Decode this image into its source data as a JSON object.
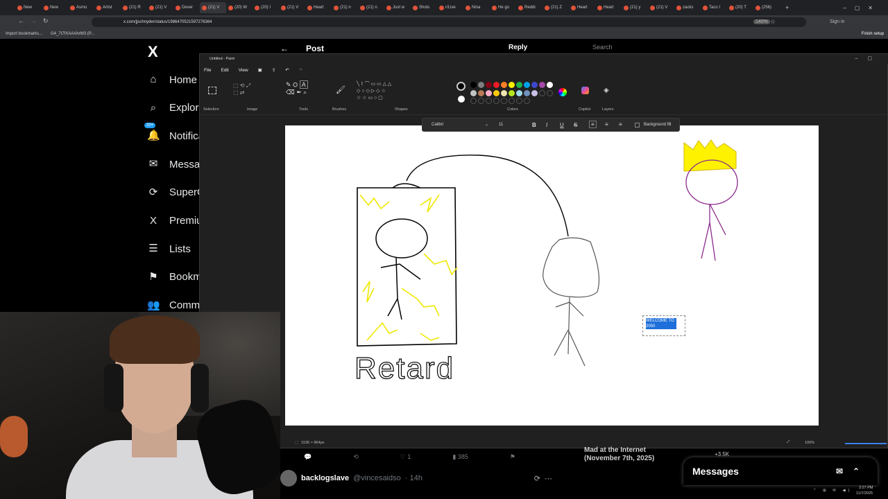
{
  "browser": {
    "tabs": [
      "New",
      "New",
      "Asmo",
      "Artist",
      "(21) R",
      "(21) V",
      "Deser",
      "(21) V",
      "(20) W",
      "(20) I",
      "(21) V",
      "Heart",
      "(21) n",
      "(21) n",
      "Just w",
      "Shots",
      "r/Live",
      "Nina",
      "He go",
      "Reddi",
      "(21) Z",
      "Heart",
      "Heart",
      "(21) y",
      "(21) V",
      "zacks",
      "Taco I",
      "(20) T",
      "(256)"
    ],
    "url": "x.com/jjschnyder/status/1986470521597276364",
    "zoom": "140%",
    "sign_in": "Sign in",
    "finish_setup": "Finish setup",
    "bookmarks": [
      "Import bookmarks...",
      "G4_7t7fXAAAhrM3 (P..."
    ]
  },
  "x": {
    "logo": "X",
    "nav": [
      {
        "label": "Home",
        "icon": "home-icon"
      },
      {
        "label": "Explore",
        "icon": "search-icon"
      },
      {
        "label": "Notifications",
        "icon": "bell-icon",
        "badge": "20+"
      },
      {
        "label": "Messages",
        "icon": "mail-icon"
      },
      {
        "label": "SuperGrok",
        "icon": "grok-icon"
      },
      {
        "label": "Premium",
        "icon": "x-icon"
      },
      {
        "label": "Lists",
        "icon": "list-icon"
      },
      {
        "label": "Bookmarks",
        "icon": "bookmark-icon"
      },
      {
        "label": "Communities",
        "icon": "people-icon"
      }
    ],
    "post_header": "Post",
    "reply_button": "Reply",
    "search_placeholder": "Search",
    "tweet_stats": {
      "likes": "1",
      "views": "385"
    },
    "reply": {
      "user": "backlogslave",
      "handle": "@vincesaidso",
      "time": "· 14h"
    },
    "trend": {
      "title": "Mad at the Internet (November 7th, 2025)",
      "count": "+3.5K"
    },
    "messages_label": "Messages"
  },
  "paint": {
    "title": "Untitled - Paint",
    "menu": [
      "File",
      "Edit",
      "View"
    ],
    "groups": [
      "Selection",
      "Image",
      "Tools",
      "Brushes",
      "Shapes",
      "Colors",
      "Copilot",
      "Layers"
    ],
    "font": "Calibri",
    "font_size": "11",
    "background_fill": "Background fill",
    "canvas_size": "1536 × 864px",
    "zoom": "100%",
    "drawing_label": "Retard",
    "text_box": "WELCOME TO 2050",
    "palette": [
      "#000000",
      "#7f7f7f",
      "#880015",
      "#ed1c24",
      "#ff7f27",
      "#fff200",
      "#22b14c",
      "#00a2e8",
      "#3f48cc",
      "#a349a4",
      "#ffffff",
      "#c3c3c3",
      "#b97a57",
      "#ffaec9",
      "#ffc90e",
      "#efe4b0",
      "#b5e61d",
      "#99d9ea",
      "#7092be",
      "#c8bfe7"
    ]
  },
  "taskbar": {
    "time": "3:27 PM",
    "date": "11/7/2025"
  }
}
